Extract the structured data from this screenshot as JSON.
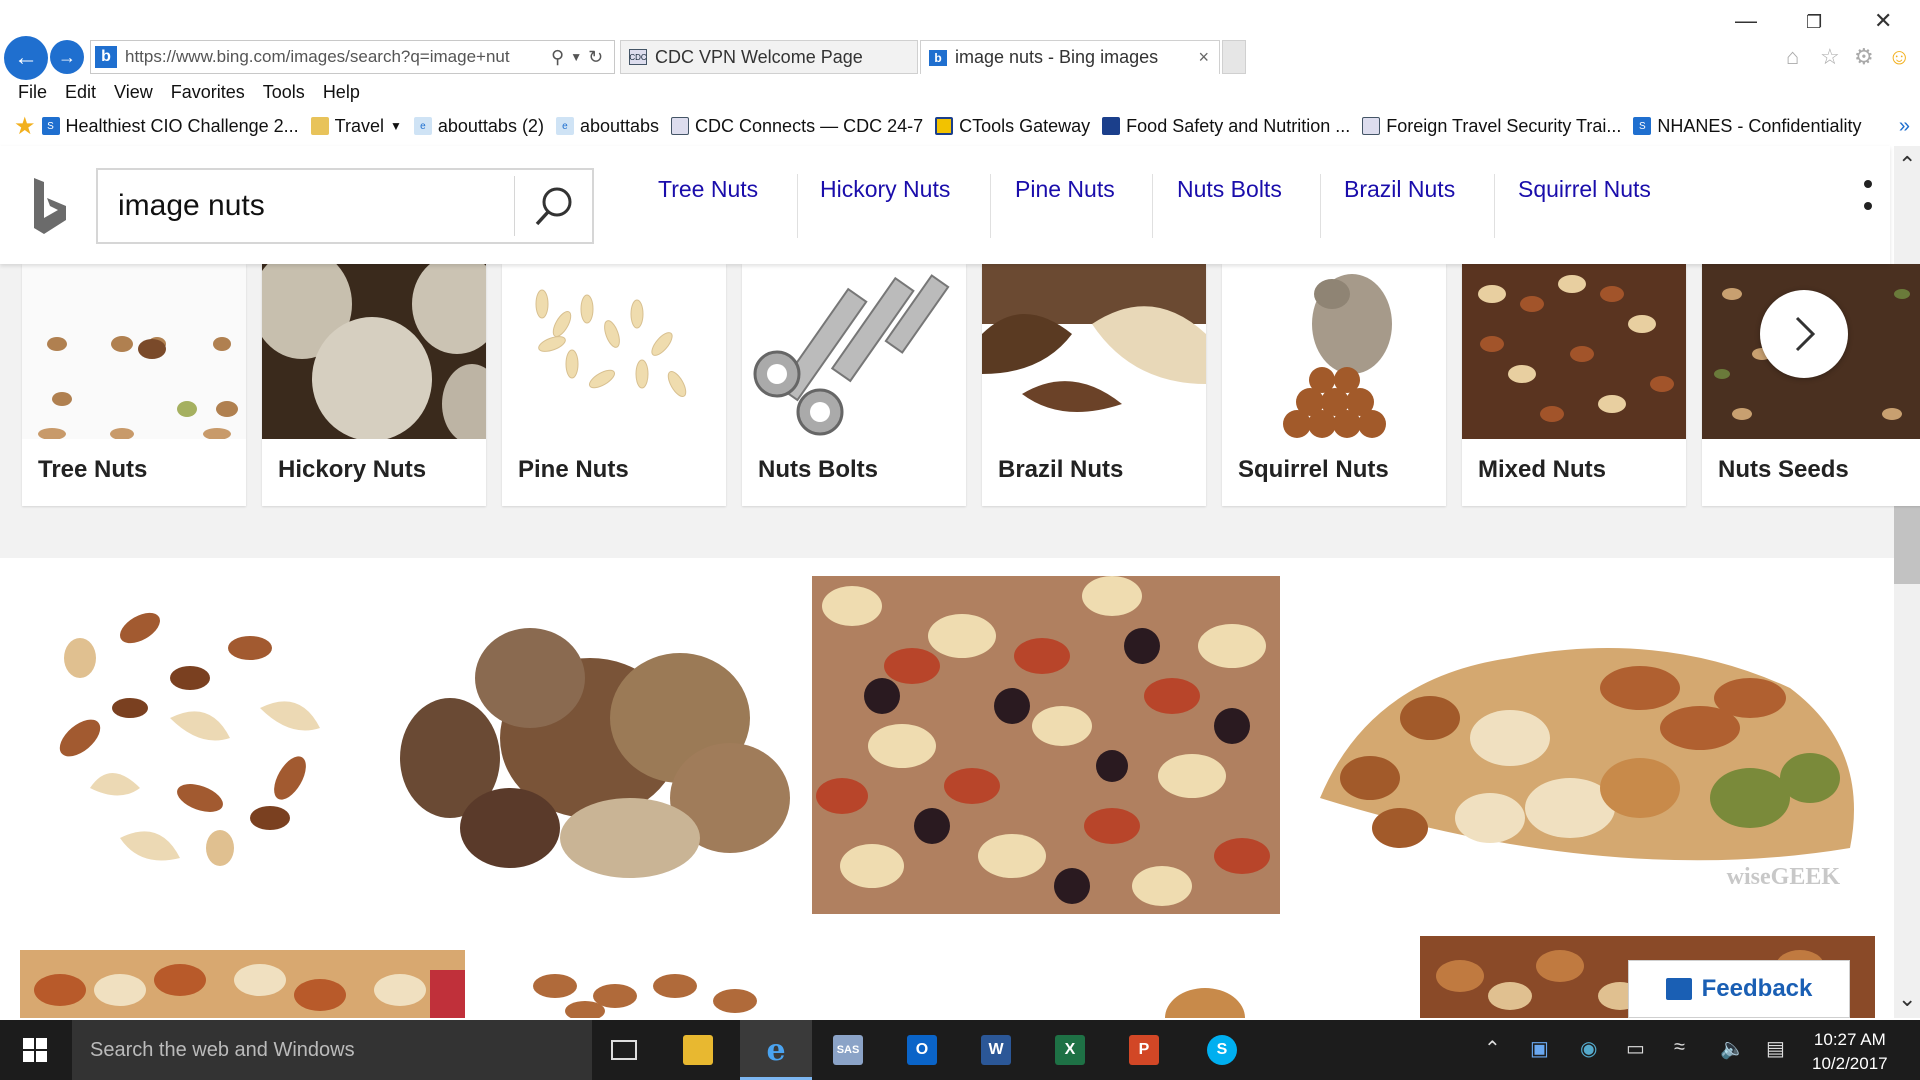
{
  "browser": {
    "address_url": "https://www.bing.com/images/search?q=image+nut",
    "tabs": [
      {
        "label": "CDC VPN Welcome Page"
      },
      {
        "label": "image nuts - Bing images"
      }
    ],
    "menu": [
      "File",
      "Edit",
      "View",
      "Favorites",
      "Tools",
      "Help"
    ],
    "favorites": [
      {
        "label": "Healthiest CIO Challenge 2..."
      },
      {
        "label": "Travel"
      },
      {
        "label": "abouttabs (2)"
      },
      {
        "label": "abouttabs"
      },
      {
        "label": "CDC Connects — CDC 24-7"
      },
      {
        "label": "CTools Gateway"
      },
      {
        "label": "Food Safety and Nutrition ..."
      },
      {
        "label": "Foreign Travel Security Trai..."
      },
      {
        "label": "NHANES - Confidentiality"
      }
    ]
  },
  "bing": {
    "query": "image nuts",
    "related_links": [
      "Tree Nuts",
      "Hickory Nuts",
      "Pine Nuts",
      "Nuts Bolts",
      "Brazil Nuts",
      "Squirrel Nuts"
    ],
    "related_cards": [
      {
        "label": "Tree Nuts"
      },
      {
        "label": "Hickory Nuts"
      },
      {
        "label": "Pine Nuts"
      },
      {
        "label": "Nuts Bolts"
      },
      {
        "label": "Brazil Nuts"
      },
      {
        "label": "Squirrel Nuts"
      },
      {
        "label": "Mixed Nuts"
      },
      {
        "label": "Nuts Seeds"
      }
    ],
    "watermark": "wiseGEEK",
    "feedback_label": "Feedback"
  },
  "taskbar": {
    "search_placeholder": "Search the web and Windows",
    "time": "10:27 AM",
    "date": "10/2/2017"
  },
  "colors": {
    "link": "#1a0dab",
    "ie_blue": "#1f6fcf",
    "taskbar": "#1c1c1c"
  }
}
